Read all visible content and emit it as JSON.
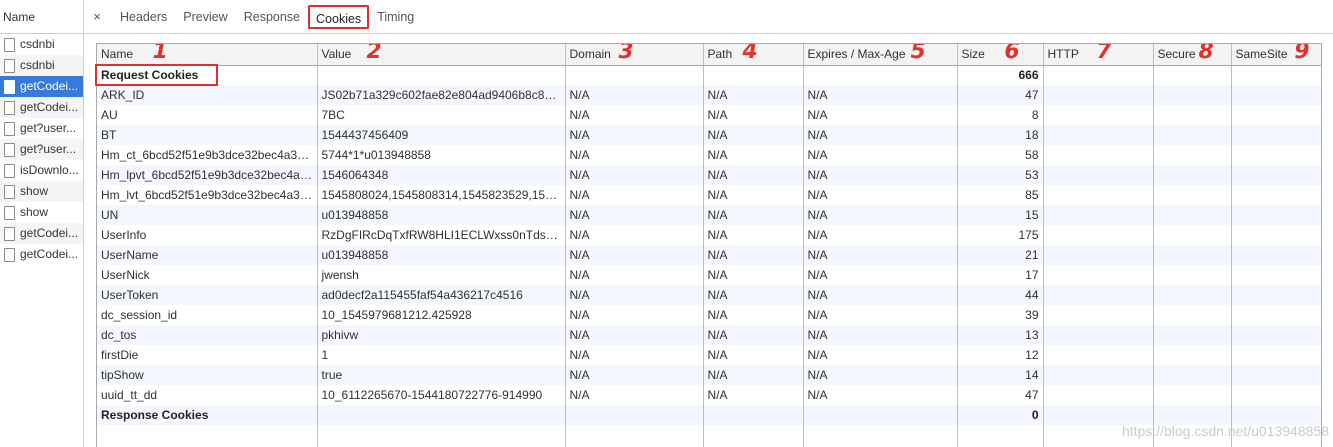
{
  "left_panel": {
    "header": "Name",
    "items": [
      {
        "name": "csdnbi"
      },
      {
        "name": "csdnbi"
      },
      {
        "name": "getCodei..."
      },
      {
        "name": "getCodei..."
      },
      {
        "name": "get?user..."
      },
      {
        "name": "get?user..."
      },
      {
        "name": "isDownlo..."
      },
      {
        "name": "show"
      },
      {
        "name": "show"
      },
      {
        "name": "getCodei..."
      },
      {
        "name": "getCodei..."
      }
    ]
  },
  "tabs": {
    "close": "×",
    "items": [
      "Headers",
      "Preview",
      "Response",
      "Cookies",
      "Timing"
    ],
    "active": "Cookies"
  },
  "columns": [
    {
      "label": "Name",
      "mark": "1"
    },
    {
      "label": "Value",
      "mark": "2"
    },
    {
      "label": "Domain",
      "mark": "3"
    },
    {
      "label": "Path",
      "mark": "4"
    },
    {
      "label": "Expires / Max-Age",
      "mark": "5"
    },
    {
      "label": "Size",
      "mark": "6"
    },
    {
      "label": "HTTP",
      "mark": "7"
    },
    {
      "label": "Secure",
      "mark": "8"
    },
    {
      "label": "SameSite",
      "mark": "9"
    }
  ],
  "request_cookies": {
    "label": "Request Cookies",
    "size": "666",
    "rows": [
      [
        "ARK_ID",
        "JS02b71a329c602fae82e804ad9406b8c802...",
        "N/A",
        "N/A",
        "N/A",
        "47"
      ],
      [
        "AU",
        "7BC",
        "N/A",
        "N/A",
        "N/A",
        "8"
      ],
      [
        "BT",
        "1544437456409",
        "N/A",
        "N/A",
        "N/A",
        "18"
      ],
      [
        "Hm_ct_6bcd52f51e9b3dce32bec4a39...",
        "5744*1*u013948858",
        "N/A",
        "N/A",
        "N/A",
        "58"
      ],
      [
        "Hm_lpvt_6bcd52f51e9b3dce32bec4a3...",
        "1546064348",
        "N/A",
        "N/A",
        "N/A",
        "53"
      ],
      [
        "Hm_lvt_6bcd52f51e9b3dce32bec4a39...",
        "1545808024,1545808314,1545823529,1545...",
        "N/A",
        "N/A",
        "N/A",
        "85"
      ],
      [
        "UN",
        "u013948858",
        "N/A",
        "N/A",
        "N/A",
        "15"
      ],
      [
        "UserInfo",
        "RzDgFIRcDqTxfRW8HLI1ECLWxss0nTdsPsSk...",
        "N/A",
        "N/A",
        "N/A",
        "175"
      ],
      [
        "UserName",
        "u013948858",
        "N/A",
        "N/A",
        "N/A",
        "21"
      ],
      [
        "UserNick",
        "jwensh",
        "N/A",
        "N/A",
        "N/A",
        "17"
      ],
      [
        "UserToken",
        "ad0decf2a115455faf54a436217c4516",
        "N/A",
        "N/A",
        "N/A",
        "44"
      ],
      [
        "dc_session_id",
        "10_1545979681212.425928",
        "N/A",
        "N/A",
        "N/A",
        "39"
      ],
      [
        "dc_tos",
        "pkhivw",
        "N/A",
        "N/A",
        "N/A",
        "13"
      ],
      [
        "firstDie",
        "1",
        "N/A",
        "N/A",
        "N/A",
        "12"
      ],
      [
        "tipShow",
        "true",
        "N/A",
        "N/A",
        "N/A",
        "14"
      ],
      [
        "uuid_tt_dd",
        "10_6112265670-1544180722776-914990",
        "N/A",
        "N/A",
        "N/A",
        "47"
      ]
    ]
  },
  "response_cookies": {
    "label": "Response Cookies",
    "size": "0"
  },
  "watermark": "https://blog.csdn.net/u013948858",
  "colors": {
    "selected_row": "#3879d9",
    "annotation_red": "#e0312f",
    "stripe": "#f4f7fd",
    "header_bg": "#f3f3f3"
  }
}
